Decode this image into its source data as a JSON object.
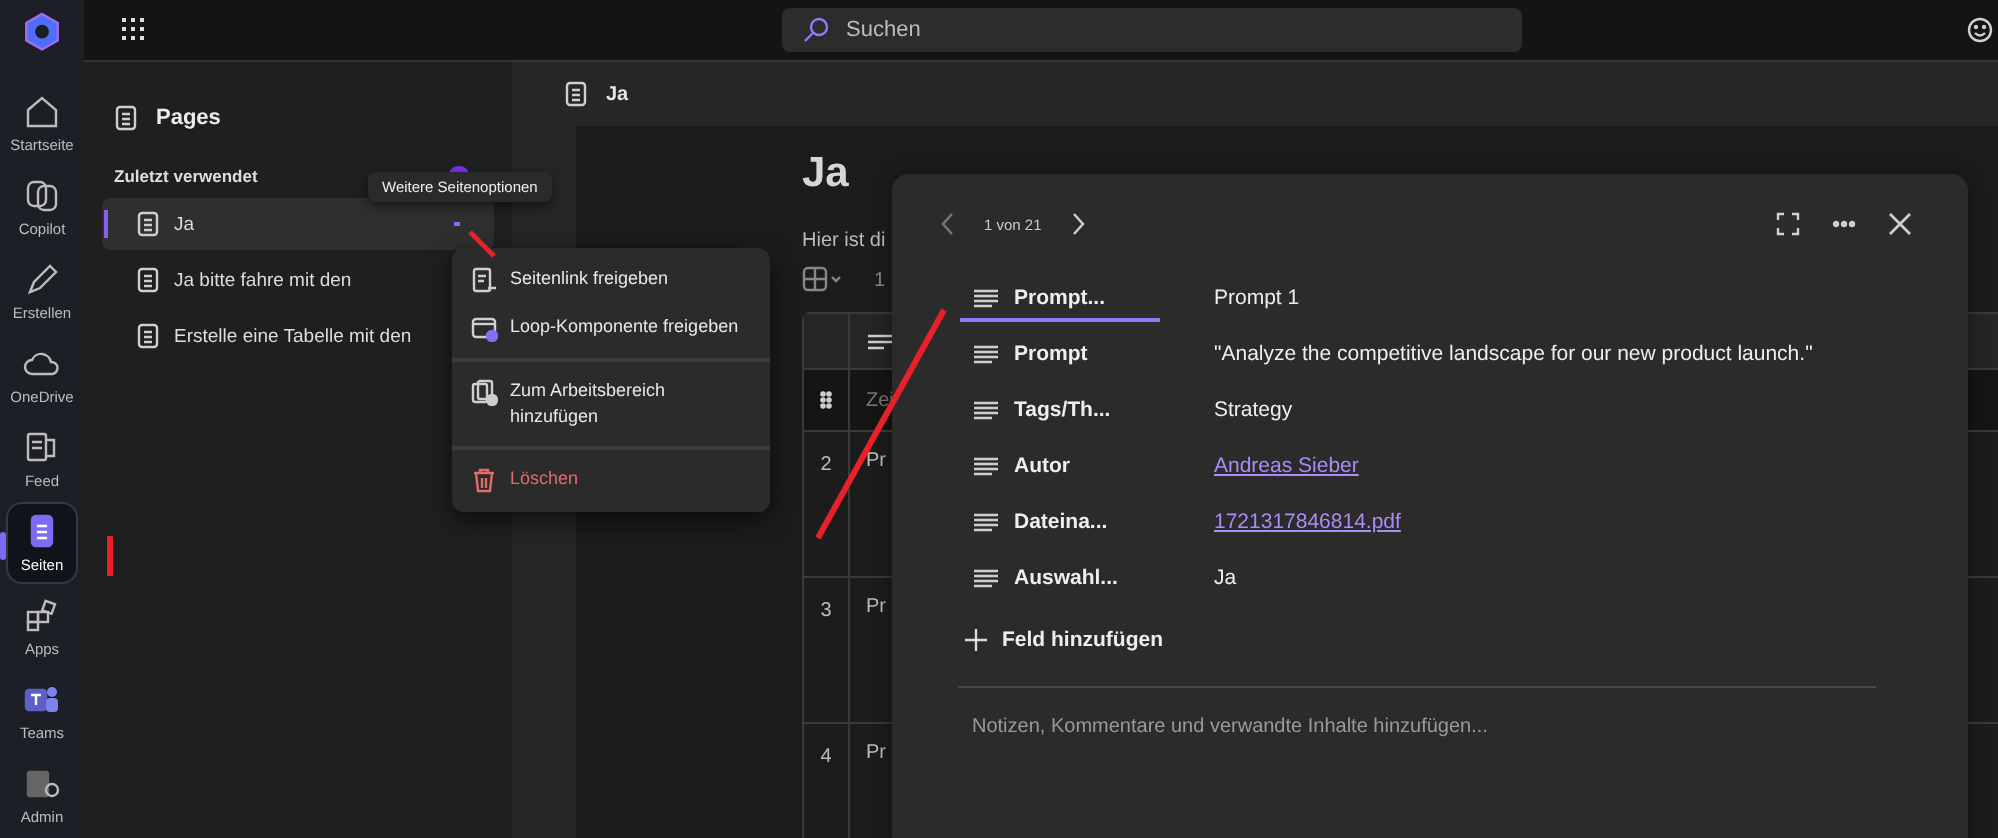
{
  "rail": {
    "items": [
      {
        "label": "Startseite",
        "selected": false
      },
      {
        "label": "Copilot",
        "selected": false
      },
      {
        "label": "Erstellen",
        "selected": false
      },
      {
        "label": "OneDrive",
        "selected": false
      },
      {
        "label": "Feed",
        "selected": false
      },
      {
        "label": "Seiten",
        "selected": true
      },
      {
        "label": "Apps",
        "selected": false
      },
      {
        "label": "Teams",
        "selected": false
      },
      {
        "label": "Admin",
        "selected": false
      }
    ]
  },
  "topbar": {
    "search": {
      "placeholder": "Suchen"
    }
  },
  "pages_panel": {
    "title": "Pages",
    "section": "Zuletzt verwendet",
    "items": [
      {
        "label": "Ja",
        "selected": true
      },
      {
        "label": "Ja bitte fahre mit den",
        "selected": false
      },
      {
        "label": "Erstelle eine Tabelle mit den",
        "selected": false
      }
    ]
  },
  "tooltip": "Weitere Seitenoptionen",
  "context_menu": {
    "groups": [
      [
        {
          "label": "Seitenlink freigeben",
          "kind": "normal"
        },
        {
          "label": "Loop-Komponente freigeben",
          "kind": "normal"
        }
      ],
      [
        {
          "label": "Zum Arbeitsbereich hinzufügen",
          "kind": "normal"
        }
      ],
      [
        {
          "label": "Löschen",
          "kind": "danger"
        }
      ]
    ]
  },
  "page": {
    "tab_title": "Ja",
    "title": "Ja",
    "intro": "Hier ist di",
    "toolbar_count": "1",
    "table": {
      "header_cell": "Zei",
      "rows": [
        {
          "number": "2",
          "cell": "Pr"
        },
        {
          "number": "3",
          "cell": "Pr"
        },
        {
          "number": "4",
          "cell": "Pr"
        }
      ]
    }
  },
  "dialog": {
    "position": "1 von 21",
    "fields": [
      {
        "label": "Prompt...",
        "value": "Prompt 1",
        "kind": "text",
        "selected": true
      },
      {
        "label": "Prompt",
        "value": "\"Analyze the competitive landscape for our new product launch.\"",
        "kind": "text",
        "selected": false
      },
      {
        "label": "Tags/Th...",
        "value": "Strategy",
        "kind": "text",
        "selected": false
      },
      {
        "label": "Autor",
        "value": "Andreas Sieber",
        "kind": "link",
        "selected": false
      },
      {
        "label": "Dateina...",
        "value": "1721317846814.pdf",
        "kind": "link",
        "selected": false
      },
      {
        "label": "Auswahl...",
        "value": "Ja",
        "kind": "text",
        "selected": false
      }
    ],
    "add_field": "Feld hinzufügen",
    "notes": {
      "placeholder": "Notizen, Kommentare und verwandte Inhalte hinzufügen..."
    }
  }
}
